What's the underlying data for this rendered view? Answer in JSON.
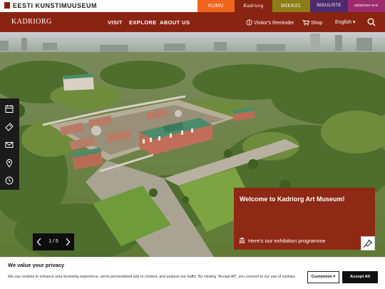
{
  "topbar": {
    "brand": "EESTI KUNSTIMUUSEUM",
    "museum_tabs": [
      {
        "label": "KUMU",
        "color": "#f0641e"
      },
      {
        "label": "Kadriorg",
        "color": "#8a2412"
      },
      {
        "label": "MIKKEL",
        "color": "#8c7d16"
      },
      {
        "label": "NIGULISTE",
        "color": "#4b2b6d"
      },
      {
        "label": "adamson-eric",
        "color": "#9c2a6c"
      }
    ]
  },
  "navbar": {
    "logo": "KADRIORG",
    "links": [
      "VISIT",
      "EXPLORE",
      "ABOUT US"
    ],
    "visitors_reminder": "Visitor's Reminder",
    "shop": "Shop",
    "language": "English"
  },
  "hero": {
    "pager": "1 / 5",
    "welcome_title": "Welcome to Kadriorg Art Museum!",
    "welcome_link": "Here's our exhibition programme"
  },
  "cookie": {
    "title": "We value your privacy",
    "text": "We use cookies to enhance your browsing experience, serve personalized ads or content, and analyze our traffic. By clicking \"Accept All\", you consent to our use of cookies.",
    "customize": "Customize",
    "accept": "Accept All"
  },
  "colors": {
    "brand_red": "#8a2412",
    "welcome_red": "#8e2915"
  }
}
